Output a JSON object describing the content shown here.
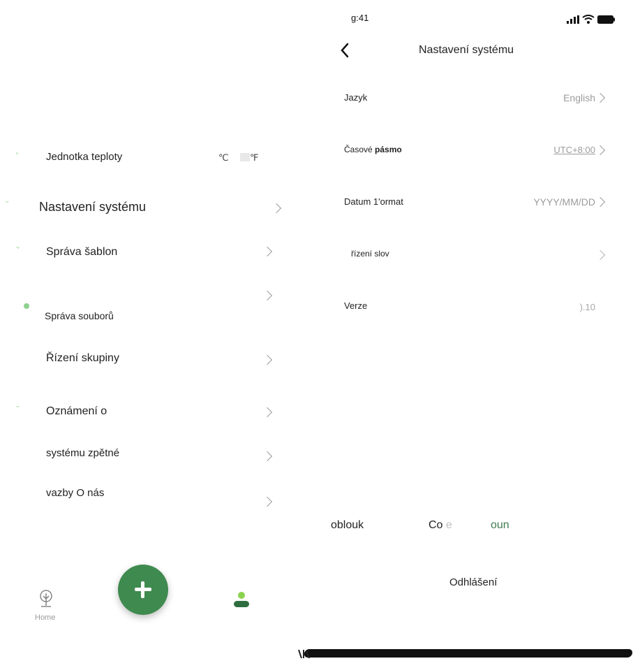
{
  "status_bar": {
    "time": "g:41"
  },
  "settings": {
    "title": "Nastavení systému",
    "rows": [
      {
        "label": "Jazyk",
        "value": "English"
      },
      {
        "label_part1": "Časové ",
        "label_part2": "pásmo",
        "value": "UTC+8:00"
      },
      {
        "label": "Datum 1'ormat",
        "value": "YYYY/MM/DD"
      },
      {
        "label": "řízení slov",
        "value": ""
      },
      {
        "label": "Verze",
        "value": ").10"
      }
    ],
    "footer": {
      "left": "oblouk",
      "middle_dark": "Co",
      "middle_light": "e",
      "right": "oun",
      "logout": "Odhlášení"
    }
  },
  "menu": {
    "temperature": {
      "label": "Jednotka teploty",
      "celsius": "℃",
      "fahrenheit": "℉"
    },
    "items": [
      "Nastavení systému",
      "Správa šablon",
      "Správa souborů",
      "Řízení skupiny",
      "Oznámení o",
      "systému zpětné",
      "vazby O nás"
    ]
  },
  "tabbar": {
    "home_label": "Home"
  },
  "colors": {
    "accent": "#3f8a4f",
    "light_accent": "#8fd08f"
  }
}
